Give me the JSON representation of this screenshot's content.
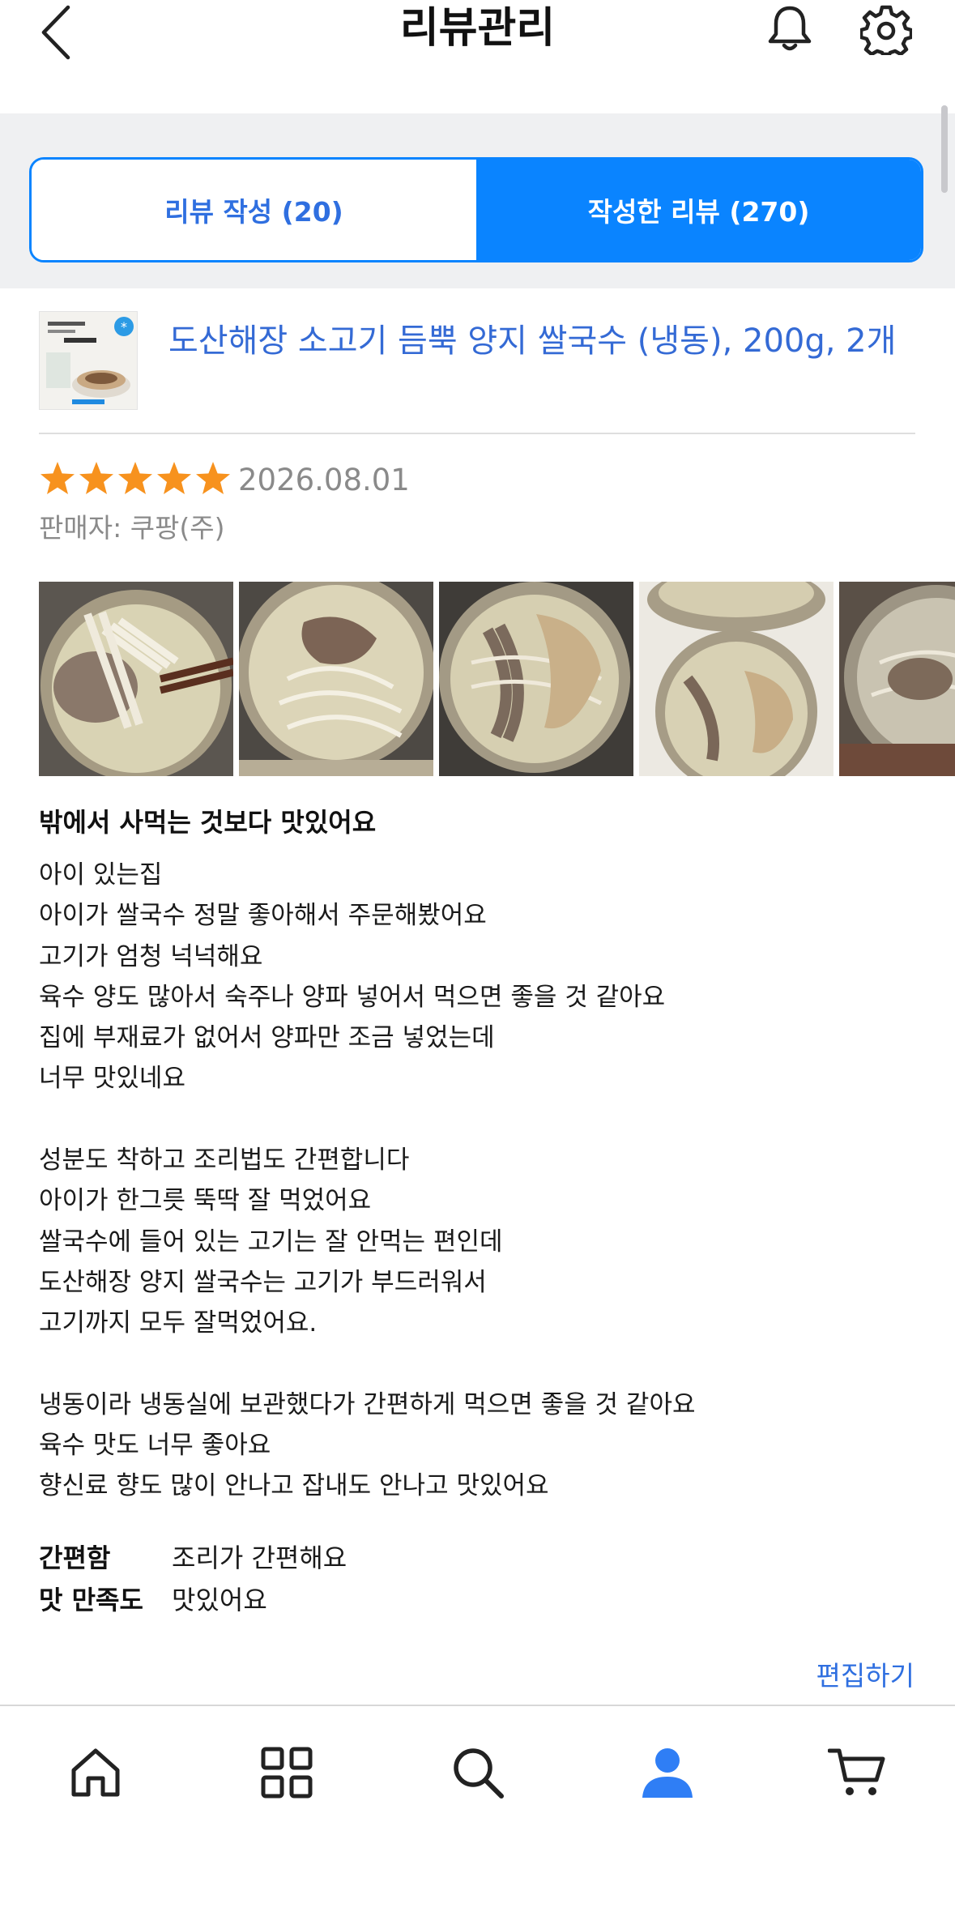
{
  "header": {
    "title": "리뷰관리",
    "back_icon": "chevron-left-icon",
    "bell_icon": "bell-icon",
    "settings_icon": "gear-icon"
  },
  "tabs": [
    {
      "label": "리뷰 작성 (20)",
      "active": false
    },
    {
      "label": "작성한 리뷰 (270)",
      "active": true
    }
  ],
  "colors": {
    "accent": "#0a84ff",
    "link": "#346ad5",
    "star": "#f7921e",
    "muted_text": "#8a8a8a"
  },
  "review": {
    "product_name": "도산해장 소고기 듬뿍 양지 쌀국수 (냉동), 200g, 2개",
    "rating": 5,
    "rating_max": 5,
    "date": "2026.08.01",
    "seller": "판매자: 쿠팡(주)",
    "photo_count_visible": 5,
    "title": "밖에서 사먹는 것보다 맛있어요",
    "body_lines": [
      "아이 있는집",
      "아이가 쌀국수 정말 좋아해서 주문해봤어요",
      "고기가 엄청 넉넉해요",
      "육수 양도 많아서 숙주나 양파 넣어서 먹으면 좋을 것 같아요",
      "집에 부재료가 없어서 양파만 조금 넣었는데",
      "너무 맛있네요",
      "",
      "성분도 착하고 조리법도 간편합니다",
      "아이가 한그릇 뚝딱 잘 먹었어요",
      "쌀국수에 들어 있는 고기는 잘 안먹는 편인데",
      "도산해장 양지 쌀국수는 고기가 부드러워서",
      "고기까지 모두 잘먹었어요.",
      "",
      "냉동이라 냉동실에 보관했다가 간편하게 먹으면 좋을 것 같아요",
      "육수 맛도 너무 좋아요",
      "향신료 향도 많이 안나고 잡내도 안나고 맛있어요"
    ],
    "attributes": [
      {
        "label": "간편함",
        "value": "조리가 간편해요"
      },
      {
        "label": "맛 만족도",
        "value": "맛있어요"
      }
    ],
    "edit_label": "편집하기"
  },
  "bottom_nav": [
    {
      "icon": "home-icon",
      "active": false
    },
    {
      "icon": "category-grid-icon",
      "active": false
    },
    {
      "icon": "search-icon",
      "active": false
    },
    {
      "icon": "profile-icon",
      "active": true
    },
    {
      "icon": "cart-icon",
      "active": false
    }
  ]
}
